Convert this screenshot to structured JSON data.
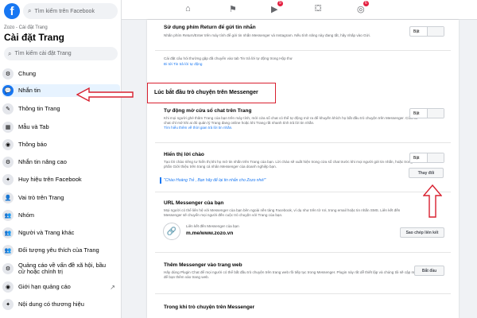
{
  "sidebar": {
    "logo": "f",
    "fb_search_placeholder": "Tìm kiếm trên Facebook",
    "breadcrumb": "Zozo - Cài đặt Trang",
    "title": "Cài đặt Trang",
    "settings_search_placeholder": "Tìm kiếm cài đặt Trang",
    "items": [
      {
        "label": "Chung",
        "icon": "gear-icon",
        "glyph": "⚙"
      },
      {
        "label": "Nhắn tin",
        "icon": "messenger-icon",
        "glyph": "💬",
        "active": true
      },
      {
        "label": "Thông tin Trang",
        "icon": "pencil-icon",
        "glyph": "✎"
      },
      {
        "label": "Mẫu và Tab",
        "icon": "grid-icon",
        "glyph": "▦"
      },
      {
        "label": "Thông báo",
        "icon": "globe-icon",
        "glyph": "◉"
      },
      {
        "label": "Nhắn tin nâng cao",
        "icon": "gear-icon",
        "glyph": "⚙"
      },
      {
        "label": "Huy hiệu trên Facebook",
        "icon": "badge-icon",
        "glyph": "✦"
      },
      {
        "label": "Vai trò trên Trang",
        "icon": "person-icon",
        "glyph": "👤"
      },
      {
        "label": "Nhóm",
        "icon": "group-icon",
        "glyph": "👥"
      },
      {
        "label": "Người và Trang khác",
        "icon": "people-icon",
        "glyph": "👥"
      },
      {
        "label": "Đối tượng yêu thích của Trang",
        "icon": "people-icon",
        "glyph": "👥"
      },
      {
        "label": "Quảng cáo về vấn đề xã hội, bầu cử hoặc chính trị",
        "icon": "gear-icon",
        "glyph": "⚙"
      },
      {
        "label": "Giới hạn quảng cáo",
        "icon": "globe-icon",
        "glyph": "◉",
        "external": true
      },
      {
        "label": "Nội dung có thương hiệu",
        "icon": "badge-icon",
        "glyph": "✦"
      }
    ]
  },
  "topbar": {
    "icons": [
      {
        "name": "home-icon",
        "glyph": "⌂"
      },
      {
        "name": "flag-icon",
        "glyph": "⚑"
      },
      {
        "name": "video-icon",
        "glyph": "▶",
        "badge": "9"
      },
      {
        "name": "marketplace-icon",
        "glyph": "⛋"
      },
      {
        "name": "groups-icon",
        "glyph": "◎",
        "badge": "6"
      }
    ]
  },
  "main": {
    "return_key": {
      "title": "Sử dụng phím Return để gửi tin nhắn",
      "desc": "Nhấn phím Return/Enter trên máy tính để gửi tin nhắn Messenger và Instagram. Nếu tính năng này đang tắt, hãy nhấp vào Gửi.",
      "toggle": "Bật"
    },
    "faq": {
      "desc": "Cài đặt câu hỏi thường gặp đã chuyển vào tab Tin trả lời tự động trong Hộp thư",
      "link": "Đi tới Tin trả lời tự động"
    },
    "highlight_heading": "Lúc bắt đầu trò chuyện trên Messenger",
    "auto_open": {
      "title": "Tự động mở cửa sổ chat trên Trang",
      "desc": "Khi mọi người ghé thăm Trang của bạn trên máy tính, mới cửa sổ chat có thể tự động mở ra để khuyến khích họ bắt đầu trò chuyện trên Messenger. Cửa sổ chat chỉ mở khi ai đó quản lý Trang đang online hoặc khi Trang rất nhanh tính trả lời tin nhắn.",
      "link": "Tìm hiểu thêm về thời gian trả lời tin nhắn.",
      "toggle": "Bật"
    },
    "greeting": {
      "title": "Hiển thị lời chào",
      "desc": "Tạo lời chào riêng tư hiển thị khi họ mở tin nhắn trên Trang của bạn. Lời chào sẽ xuất hiện trong cửa sổ chat trước khi mọi người gửi tin nhắn, hoặc trong phần Giới thiệu trên trang cá nhân Messenger của doanh nghiệp bạn.",
      "toggle": "Bật",
      "change_button": "Thay đổi",
      "quote": "\"Chào Hoàng Trẻ , Bạn hãy để lại tin nhắn cho Zozo nhé!\""
    },
    "url": {
      "title": "URL Messenger của bạn",
      "desc": "Mọi người có thể liên hệ với Messenger của bạn bên ngoài nền tảng Facebook, ví dụ như trên tờ rơi, trong email hoặc tin nhắn SMS. Liên kết đến Messenger sẽ chuyển mọi người đến cuộc trò chuyện với Trang của bạn.",
      "label": "Liên kết đến Messenger của bạn",
      "value": "m.me/www.zozo.vn",
      "copy_button": "Sao chép liên kết"
    },
    "web": {
      "title": "Thêm Messenger vào trang web",
      "desc": "Hãy dùng Plugin Chat để mọi người có thể bắt đầu trò chuyện trên trang web rồi tiếp tục trong Messenger. Plugin này rất dễ thiết lập và chúng tôi sẽ cập mã để bạn thêm vào trang web.",
      "button": "Bắt đầu"
    },
    "bottom_heading": "Trong khi trò chuyện trên Messenger"
  },
  "colors": {
    "accent": "#1877f2",
    "annotation": "#d8202f"
  }
}
